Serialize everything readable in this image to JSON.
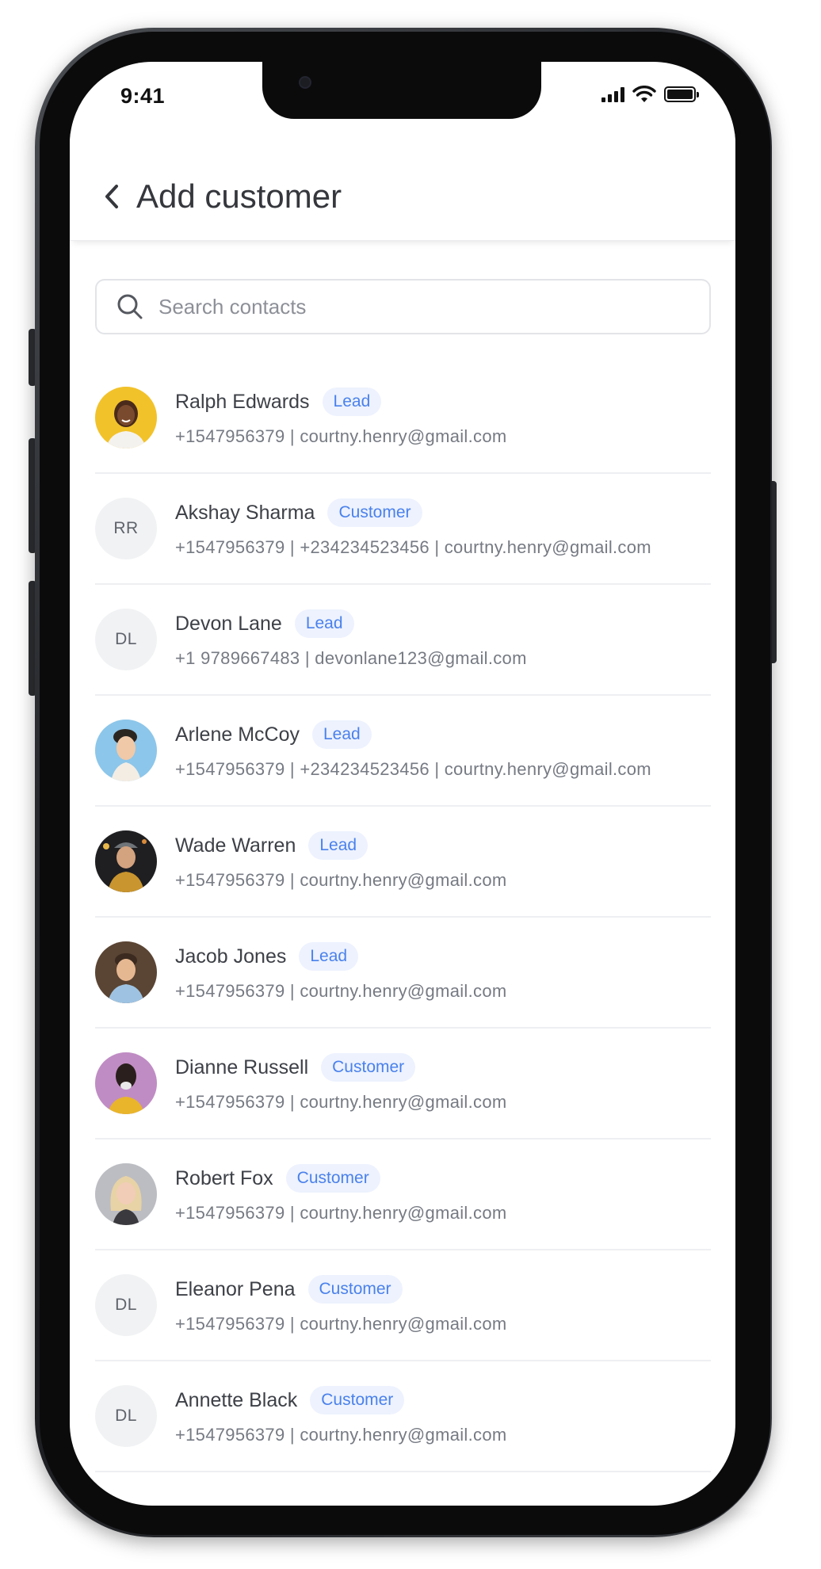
{
  "status_bar": {
    "time": "9:41"
  },
  "header": {
    "title": "Add customer"
  },
  "search": {
    "placeholder": "Search contacts",
    "value": ""
  },
  "colors": {
    "tag_text": "#4a81ec",
    "tag_bg": "#edf2fe",
    "title": "#35373d",
    "divider": "#eeeff2"
  },
  "contacts": [
    {
      "name": "Ralph Edwards",
      "tag": "Lead",
      "details": "+1547956379 | courtny.henry@gmail.com",
      "avatar": "photo",
      "avatar_bg": "#f2c22a"
    },
    {
      "name": "Akshay Sharma",
      "tag": "Customer",
      "details": "+1547956379 | +234234523456 | courtny.henry@gmail.com",
      "avatar": "initials",
      "initials": "RR"
    },
    {
      "name": "Devon Lane",
      "tag": "Lead",
      "details": "+1 9789667483 | devonlane123@gmail.com",
      "avatar": "initials",
      "initials": "DL"
    },
    {
      "name": "Arlene McCoy",
      "tag": "Lead",
      "details": "+1547956379 | +234234523456 | courtny.henry@gmail.com",
      "avatar": "photo",
      "avatar_bg": "#8cc6ea"
    },
    {
      "name": "Wade Warren",
      "tag": "Lead",
      "details": "+1547956379 | courtny.henry@gmail.com",
      "avatar": "photo",
      "avatar_bg": "#1f1f22"
    },
    {
      "name": "Jacob Jones",
      "tag": "Lead",
      "details": "+1547956379 | courtny.henry@gmail.com",
      "avatar": "photo",
      "avatar_bg": "#5a4433"
    },
    {
      "name": "Dianne Russell",
      "tag": "Customer",
      "details": "+1547956379 | courtny.henry@gmail.com",
      "avatar": "photo",
      "avatar_bg": "#c08cc4"
    },
    {
      "name": "Robert Fox",
      "tag": "Customer",
      "details": "+1547956379 | courtny.henry@gmail.com",
      "avatar": "photo",
      "avatar_bg": "#bcbdc2"
    },
    {
      "name": "Eleanor Pena",
      "tag": "Customer",
      "details": "+1547956379 | courtny.henry@gmail.com",
      "avatar": "initials",
      "initials": "DL"
    },
    {
      "name": "Annette Black",
      "tag": "Customer",
      "details": "+1547956379 | courtny.henry@gmail.com",
      "avatar": "initials",
      "initials": "DL"
    }
  ]
}
